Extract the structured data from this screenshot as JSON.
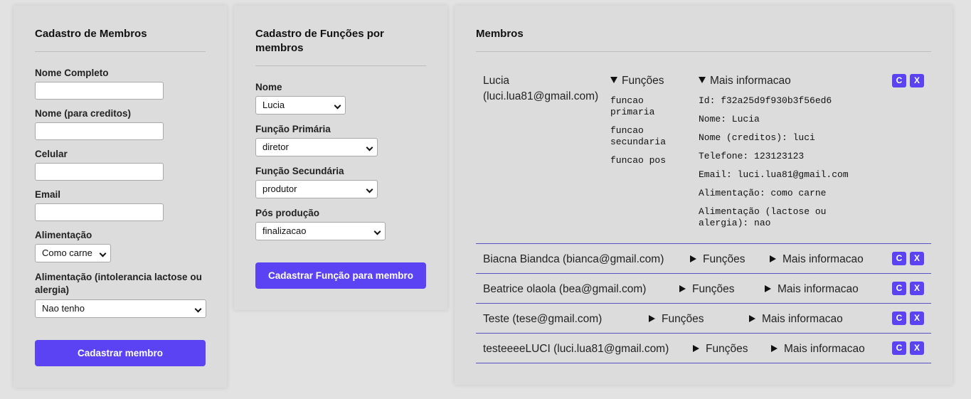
{
  "members_form": {
    "title": "Cadastro de Membros",
    "full_name_label": "Nome Completo",
    "credit_name_label": "Nome (para creditos)",
    "phone_label": "Celular",
    "email_label": "Email",
    "food_label": "Alimentação",
    "food_value": "Como carne",
    "intolerance_label": "Alimentação (intolerancia lactose ou alergia)",
    "intolerance_value": "Nao tenho",
    "submit_label": "Cadastrar membro"
  },
  "roles_form": {
    "title": "Cadastro de Funções por membros",
    "name_label": "Nome",
    "name_value": "Lucia",
    "primary_label": "Função Primária",
    "primary_value": "diretor",
    "secondary_label": "Função Secundária",
    "secondary_value": "produtor",
    "post_label": "Pós produção",
    "post_value": "finalizacao",
    "submit_label": "Cadastrar Função para membro"
  },
  "members_list": {
    "title": "Membros",
    "functions_label": "Funções",
    "more_info_label": "Mais informacao",
    "edit_label": "C",
    "delete_label": "X",
    "expanded": {
      "name": "Lucia",
      "email": "(luci.lua81@gmail.com)",
      "functions": [
        "funcao primaria",
        "funcao secundaria",
        "funcao pos"
      ],
      "info": [
        "Id: f32a25d9f930b3f56ed6",
        "Nome: Lucia",
        "Nome (creditos): luci",
        "Telefone: 123123123",
        "Email: luci.lua81@gmail.com",
        "Alimentação: como carne",
        "Alimentação (lactose ou alergia): nao"
      ]
    },
    "rows": [
      "Biacna Biandca (bianca@gmail.com)",
      "Beatrice olaola (bea@gmail.com)",
      "Teste (tese@gmail.com)",
      "testeeeeLUCI (luci.lua81@gmail.com)"
    ]
  }
}
